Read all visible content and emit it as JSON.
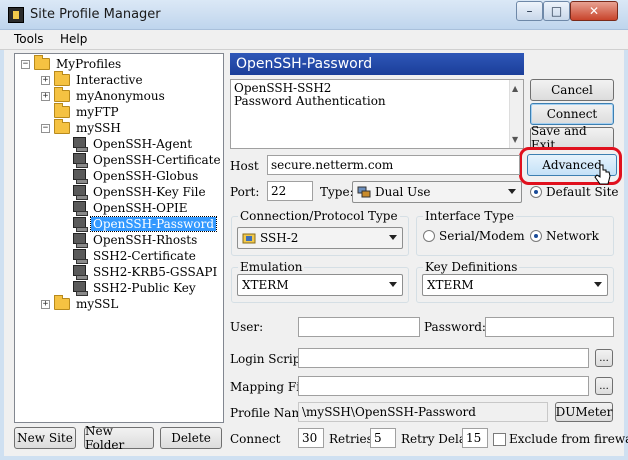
{
  "window": {
    "title": "Site Profile Manager",
    "minimize_glyph": "–",
    "maximize_glyph": "□",
    "close_glyph": "✕"
  },
  "menu": {
    "items": [
      "Tools",
      "Help"
    ]
  },
  "tree": {
    "expander_collapsed": "+",
    "expander_expanded": "−",
    "root": "MyProfiles",
    "folders": [
      "Interactive",
      "myAnonymous",
      "myFTP",
      "mySSH",
      "mySSL"
    ],
    "ssh_profiles": [
      "OpenSSH-Agent",
      "OpenSSH-Certificate",
      "OpenSSH-Globus",
      "OpenSSH-Key File",
      "OpenSSH-OPIE",
      "OpenSSH-Password",
      "OpenSSH-Rhosts",
      "SSH2-Certificate",
      "SSH2-KRB5-GSSAPI",
      "SSH2-Public Key"
    ],
    "selected": "OpenSSH-Password"
  },
  "bottom_buttons": {
    "new_site": "New Site",
    "new_folder": "New Folder",
    "delete": "Delete"
  },
  "profile": {
    "header": "OpenSSH-Password",
    "description_line1": "OpenSSH-SSH2",
    "description_line2": "Password Authentication"
  },
  "side_buttons": {
    "cancel": "Cancel",
    "connect": "Connect",
    "save_exit": "Save and Exit",
    "advanced": "Advanced"
  },
  "form": {
    "host_label": "Host",
    "host_value": "secure.netterm.com",
    "port_label": "Port:",
    "port_value": "22",
    "type_label": "Type:",
    "type_value": "Dual Use",
    "default_site_label": "Default Site",
    "connection_group": "Connection/Protocol  Type",
    "connection_value": "SSH-2",
    "interface_group": "Interface Type",
    "interface_serial": "Serial/Modem",
    "interface_network": "Network",
    "emulation_group": "Emulation",
    "emulation_value": "XTERM",
    "keydef_group": "Key Definitions",
    "keydef_value": "XTERM",
    "user_label": "User:",
    "user_value": "",
    "password_label": "Password:",
    "password_value": "",
    "login_script_label": "Login Script:",
    "login_script_value": "",
    "mapping_file_label": "Mapping File:",
    "mapping_file_value": "",
    "browse_label": "...",
    "profile_name_label": "Profile Name:",
    "profile_name_value": "\\mySSH\\OpenSSH-Password",
    "dumeter_label": "DUMeter",
    "connect_label": "Connect",
    "connect_value": "30",
    "retries_label": "Retries:",
    "retries_value": "5",
    "retry_delay_label": "Retry Delay:",
    "retry_delay_value": "15",
    "exclude_firewall_label": "Exclude from firewall"
  },
  "colors": {
    "header_blue": "#1b3e99",
    "selection": "#3399ff",
    "highlight_red": "#e0101d"
  }
}
